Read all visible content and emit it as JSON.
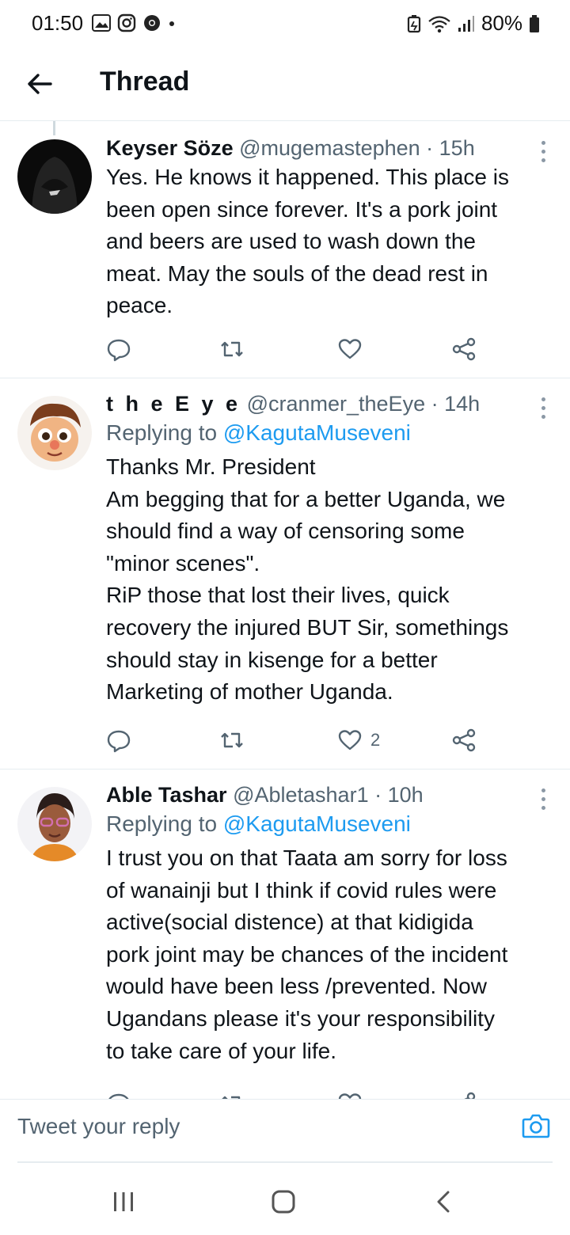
{
  "status_bar": {
    "time": "01:50",
    "battery": "80%",
    "left_icons": [
      "gallery-icon",
      "instagram-icon",
      "chrome-icon",
      "dot-icon"
    ],
    "right_icons": [
      "battery-saver-icon",
      "wifi-icon",
      "signal-icon",
      "battery-icon"
    ]
  },
  "app_bar": {
    "title": "Thread",
    "back_icon": "arrow-left-icon"
  },
  "tweets": [
    {
      "display_name": "Keyser Söze",
      "handle": "@mugemastephen",
      "time": "· 15h",
      "replying_prefix": "",
      "replying_to": "",
      "text": "Yes. He knows it happened. This place is\nbeen open since forever. It's a pork joint\nand beers are used to wash down the\nmeat. May the souls of the dead rest in\npeace.",
      "likes": ""
    },
    {
      "display_name": "t h e E y e",
      "handle": "@cranmer_theEye",
      "time": "· 14h",
      "replying_prefix": "Replying to",
      "replying_to": "@KagutaMuseveni",
      "text": "Thanks Mr. President\nAm begging that for a better Uganda, we\nshould find a way of censoring some\n\"minor scenes\".\nRiP those that lost their lives, quick\nrecovery the injured BUT Sir, somethings\nshould stay in kisenge for a better\nMarketing of mother Uganda.",
      "likes": "2"
    },
    {
      "display_name": "Able Tashar",
      "handle": "@Abletashar1",
      "time": "· 10h",
      "replying_prefix": "Replying to",
      "replying_to": "@KagutaMuseveni",
      "text": "I trust you on that Taata am sorry for loss\nof wanainji but I think if covid rules were\nactive(social distence) at that kidigida\npork joint may be chances of the incident\nwould have been less /prevented. Now\nUgandans please it's your responsibility\nto take care of your life.",
      "likes": ""
    }
  ],
  "reply_bar": {
    "placeholder": "Tweet your reply",
    "camera_icon": "camera-icon"
  },
  "nav_bar": {
    "icons": [
      "recent-apps-icon",
      "home-icon",
      "back-icon"
    ]
  },
  "colors": {
    "accent": "#1d9bf0",
    "text": "#0f1419",
    "secondary": "#536471",
    "divider": "#e6ecf0"
  }
}
